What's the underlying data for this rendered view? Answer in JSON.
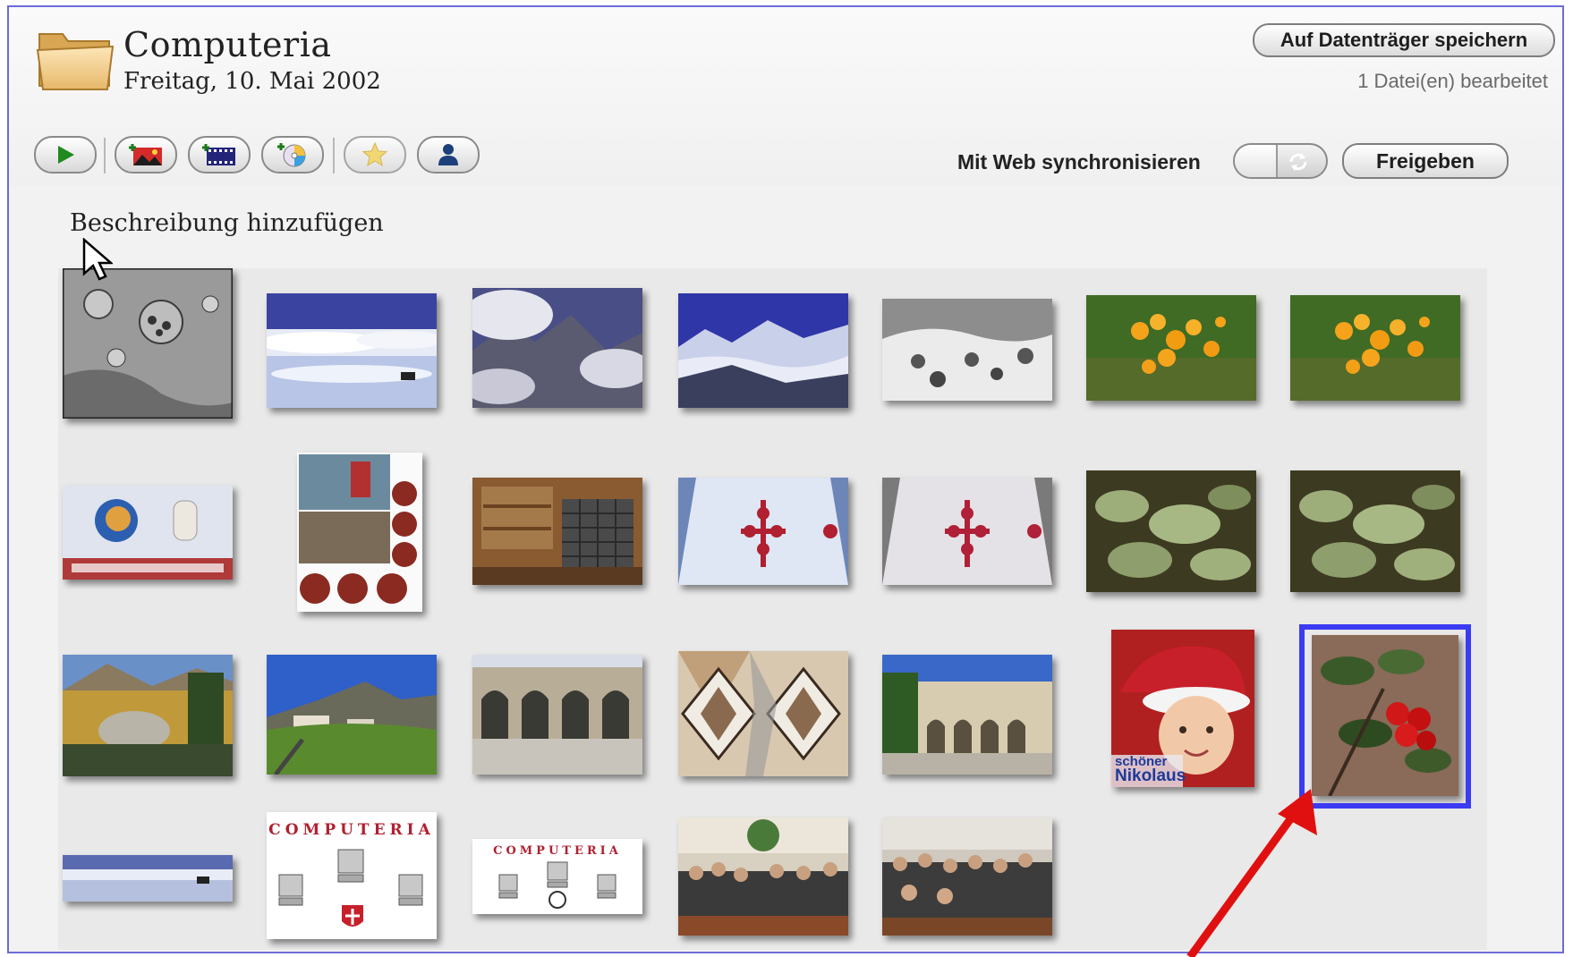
{
  "album": {
    "title": "Computeria",
    "date": "Freitag, 10. Mai 2002"
  },
  "header": {
    "save_label": "Auf Datenträger speichern",
    "edited_count": "1 Datei(en) bearbeitet",
    "sync_label": "Mit Web synchronisieren",
    "share_label": "Freigeben"
  },
  "toolbar": {
    "buttons": [
      {
        "name": "play-slideshow-button",
        "icon": "play-icon"
      },
      {
        "name": "add-photo-button",
        "icon": "add-photo-icon"
      },
      {
        "name": "add-movie-button",
        "icon": "add-movie-icon"
      },
      {
        "name": "add-media-button",
        "icon": "add-disc-icon"
      },
      {
        "name": "rate-button",
        "icon": "star-icon"
      },
      {
        "name": "people-button",
        "icon": "person-icon"
      }
    ]
  },
  "description": {
    "placeholder": "Beschreibung hinzufügen"
  },
  "photos": {
    "rows": [
      [
        "micrograph-cells",
        "salt-flat-reflection",
        "mountain-clouds",
        "snowy-mountain-range",
        "micrograph-virus",
        "orange-flowers",
        "orange-flowers"
      ],
      [
        "thunderbird-portable-banner",
        "nikolaus-collage",
        "kitchen-interior",
        "embroidered-tablecloth",
        "embroidered-tablecloth",
        "alpine-plants",
        "alpine-plants"
      ],
      [
        "autumn-forest-boulder",
        "alpine-village",
        "arcade-building",
        "tiled-floor",
        "arcade-courtyard",
        "baby-santa-hat",
        "red-berries"
      ],
      [
        "salt-flat-panorama",
        "computeria-logo-crest",
        "computeria-logo",
        "seminar-audience",
        "seminar-audience"
      ]
    ],
    "selected": "red-berries",
    "captions": {
      "nikolaus_line1": "schöner",
      "nikolaus_line2": "Nikolaus",
      "computeria_logo": "COMPUTERIA"
    }
  },
  "colors": {
    "accent_selection": "#3b3bf2",
    "annotation_arrow": "#e01010"
  }
}
